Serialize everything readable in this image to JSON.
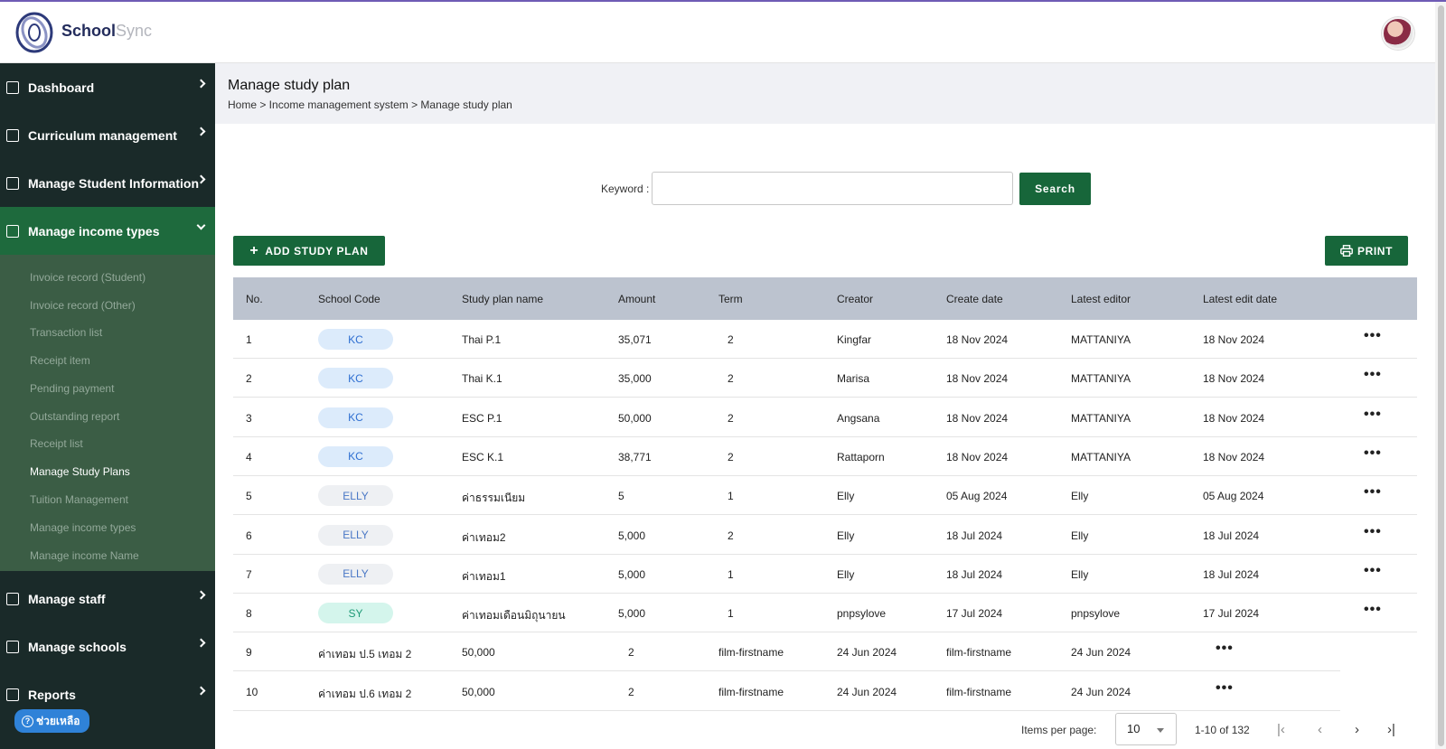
{
  "header": {
    "brand_primary": "School",
    "brand_secondary": "Sync"
  },
  "sidebar": {
    "items": [
      {
        "label": "Dashboard",
        "icon": "grid-icon"
      },
      {
        "label": "Curriculum management",
        "icon": "graduation-cap-icon"
      },
      {
        "label": "Manage Student Information",
        "icon": "student-icon"
      },
      {
        "label": "Manage income types",
        "icon": "money-icon"
      },
      {
        "label": "Manage staff",
        "icon": "staff-icon"
      },
      {
        "label": "Manage schools",
        "icon": "school-icon"
      },
      {
        "label": "Reports",
        "icon": "report-icon"
      }
    ],
    "submenu": [
      "Invoice record (Student)",
      "Invoice record (Other)",
      "Transaction list",
      "Receipt item",
      "Pending payment",
      "Outstanding report",
      "Receipt list",
      "Manage Study Plans",
      "Tuition Management",
      "Manage income types",
      "Manage income Name"
    ],
    "help_label": "ช่วยเหลือ"
  },
  "page": {
    "title": "Manage study plan",
    "breadcrumb": "Home > Income management system > Manage study plan"
  },
  "search": {
    "label": "Keyword :",
    "value": "",
    "button": "Search"
  },
  "toolbar": {
    "add_label": "ADD STUDY PLAN",
    "print_label": "PRINT"
  },
  "table": {
    "headers": [
      "No.",
      "School Code",
      "Study plan name",
      "Amount",
      "Term",
      "Creator",
      "Create date",
      "Latest editor",
      "Latest edit date"
    ],
    "rows": [
      {
        "no": "1",
        "code": "KC",
        "name": "Thai P.1",
        "amount": "35,071",
        "term": "2",
        "creator": "Kingfar",
        "created": "18 Nov 2024",
        "editor": "MATTANIYA",
        "edited": "18 Nov 2024"
      },
      {
        "no": "2",
        "code": "KC",
        "name": "Thai K.1",
        "amount": "35,000",
        "term": "2",
        "creator": "Marisa",
        "created": "18 Nov 2024",
        "editor": "MATTANIYA",
        "edited": "18 Nov 2024"
      },
      {
        "no": "3",
        "code": "KC",
        "name": "ESC P.1",
        "amount": "50,000",
        "term": "2",
        "creator": "Angsana",
        "created": "18 Nov 2024",
        "editor": "MATTANIYA",
        "edited": "18 Nov 2024"
      },
      {
        "no": "4",
        "code": "KC",
        "name": "ESC K.1",
        "amount": "38,771",
        "term": "2",
        "creator": "Rattaporn",
        "created": "18 Nov 2024",
        "editor": "MATTANIYA",
        "edited": "18 Nov 2024"
      },
      {
        "no": "5",
        "code": "ELLY",
        "name": "ค่าธรรมเนียม",
        "amount": "5",
        "term": "1",
        "creator": "Elly",
        "created": "05 Aug 2024",
        "editor": "Elly",
        "edited": "05 Aug 2024"
      },
      {
        "no": "6",
        "code": "ELLY",
        "name": "ค่าเทอม2",
        "amount": "5,000",
        "term": "2",
        "creator": "Elly",
        "created": "18 Jul 2024",
        "editor": "Elly",
        "edited": "18 Jul 2024"
      },
      {
        "no": "7",
        "code": "ELLY",
        "name": "ค่าเทอม1",
        "amount": "5,000",
        "term": "1",
        "creator": "Elly",
        "created": "18 Jul 2024",
        "editor": "Elly",
        "edited": "18 Jul 2024"
      },
      {
        "no": "8",
        "code": "SY",
        "name": "ค่าเทอมเดือนมิถุนายน",
        "amount": "5,000",
        "term": "1",
        "creator": "pnpsylove",
        "created": "17 Jul 2024",
        "editor": "pnpsylove",
        "edited": "17 Jul 2024"
      }
    ],
    "rows_no_code": [
      {
        "no": "9",
        "name": "ค่าเทอม ป.5 เทอม 2",
        "amount": "50,000",
        "term": "2",
        "creator": "film-firstname",
        "created": "24 Jun 2024",
        "editor": "film-firstname",
        "edited": "24 Jun 2024"
      },
      {
        "no": "10",
        "name": "ค่าเทอม ป.6 เทอม 2",
        "amount": "50,000",
        "term": "2",
        "creator": "film-firstname",
        "created": "24 Jun 2024",
        "editor": "film-firstname",
        "edited": "24 Jun 2024"
      }
    ],
    "more_label": "•••"
  },
  "badge_colors": {
    "KC": {
      "bg": "#dcebfb",
      "fg": "#2f6fd1"
    },
    "ELLY": {
      "bg": "#eef0f3",
      "fg": "#4a78c6"
    },
    "SY": {
      "bg": "#d4f5ec",
      "fg": "#1f9a77"
    }
  },
  "pagination": {
    "items_label": "Items per page:",
    "page_size": "10",
    "range": "1-10 of 132",
    "first": "|‹",
    "prev": "‹",
    "next": "›",
    "last": "›|"
  }
}
